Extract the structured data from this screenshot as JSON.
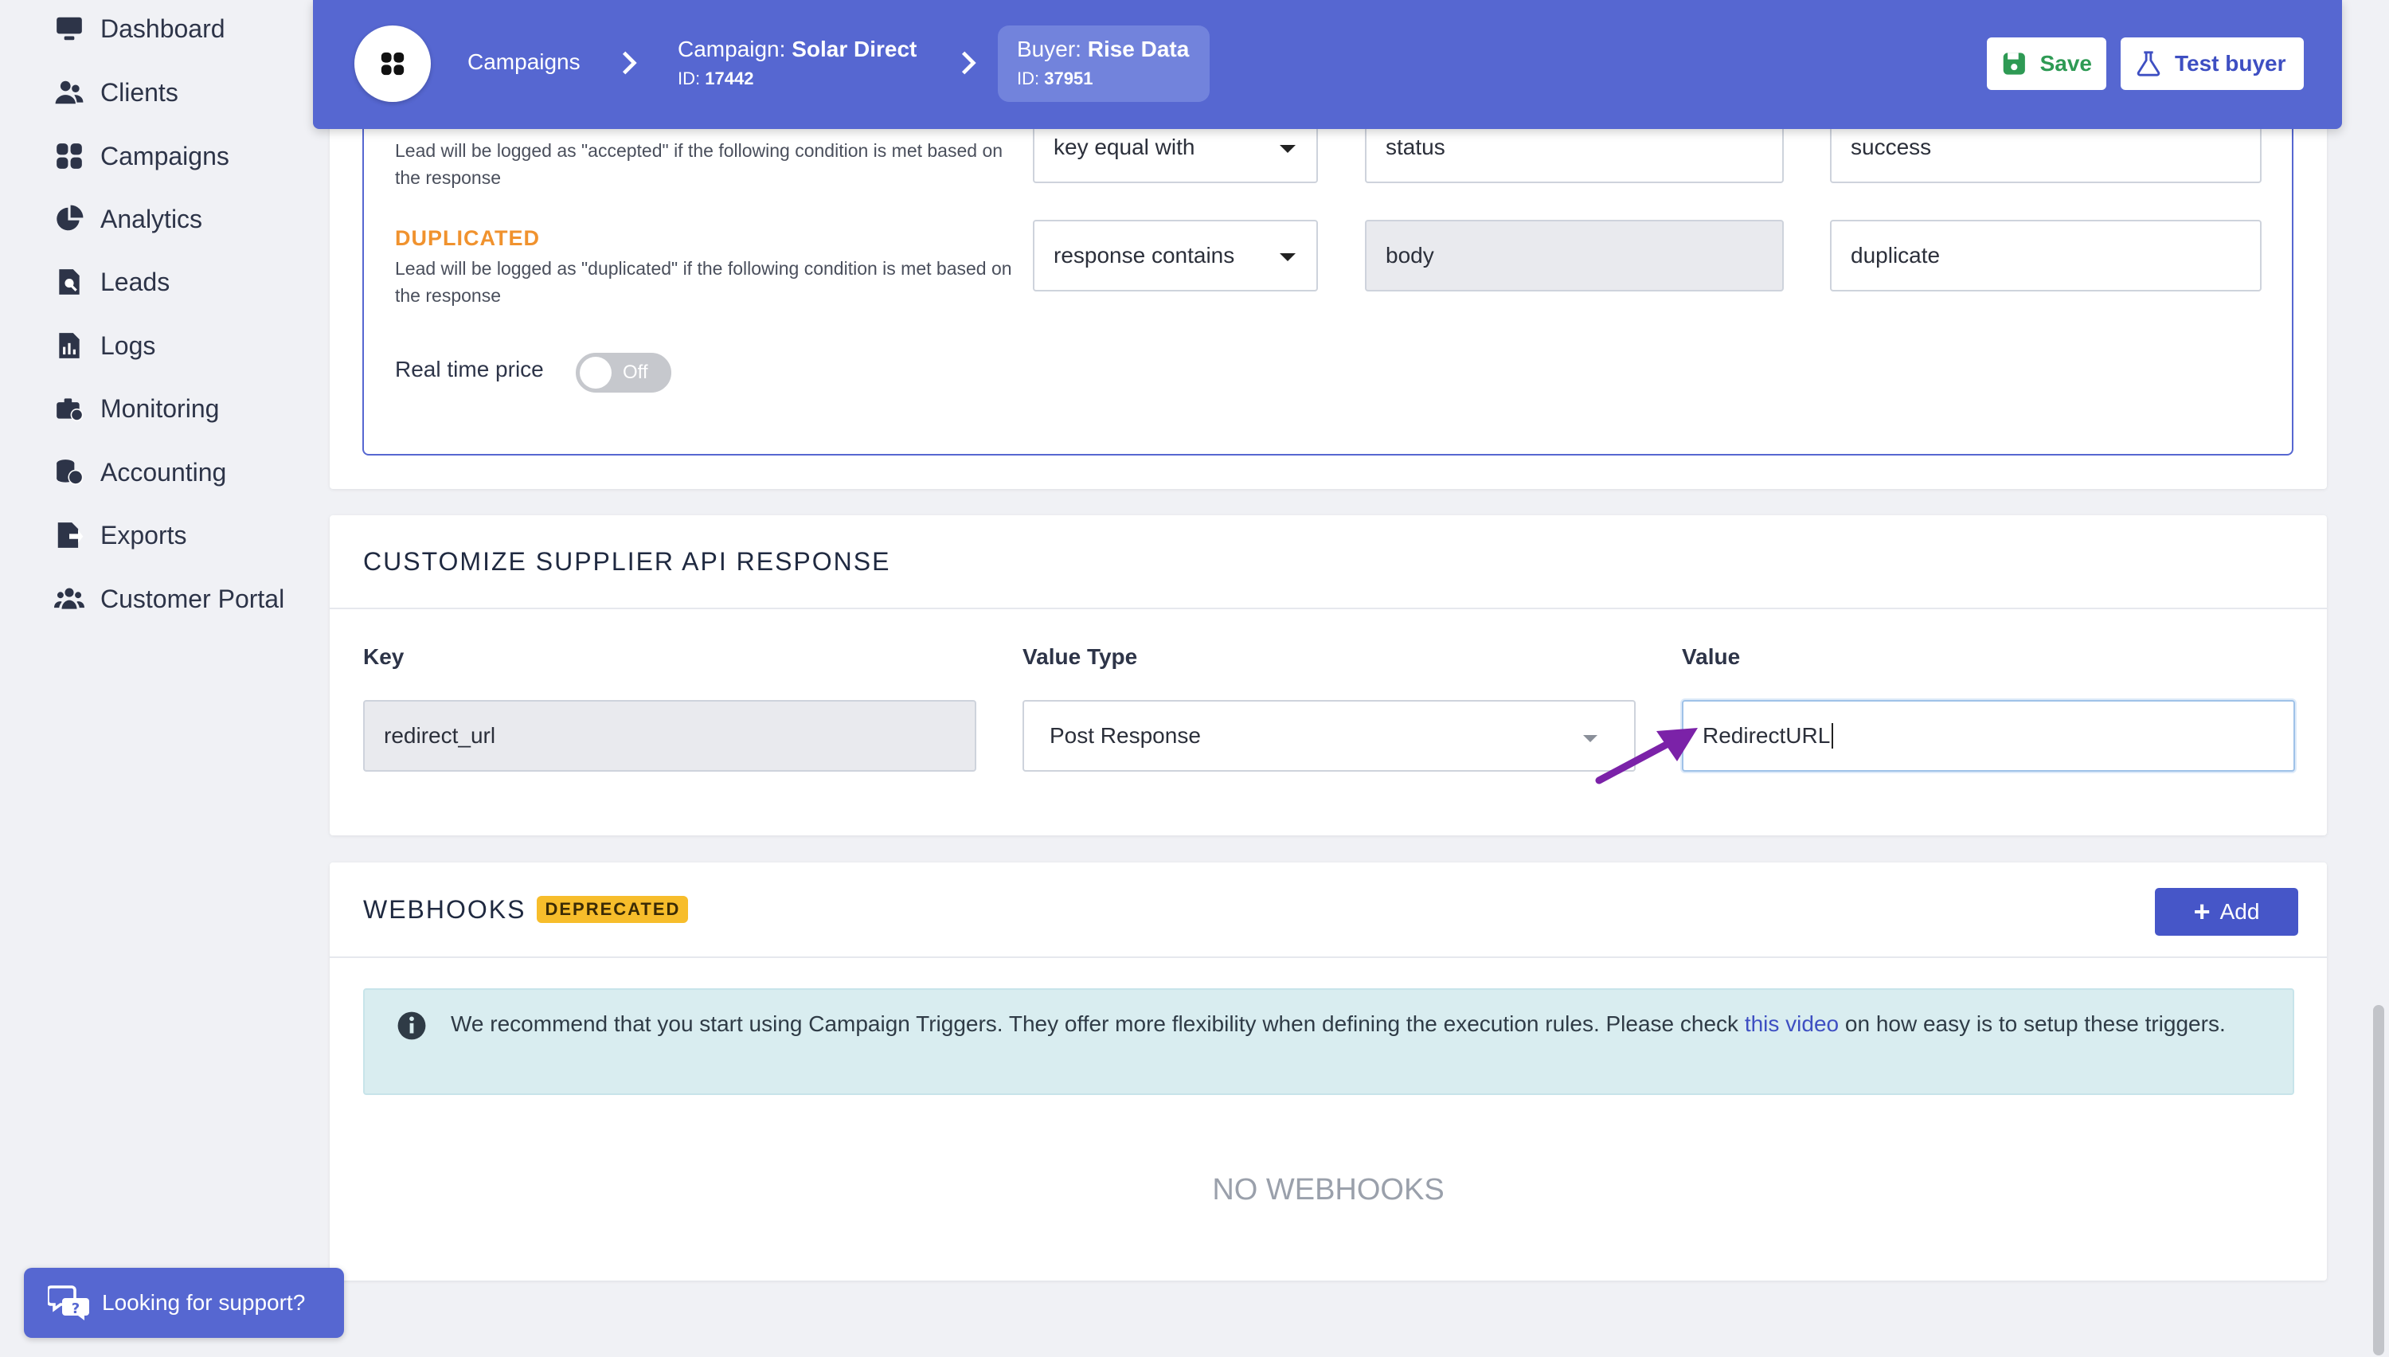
{
  "sidebar": {
    "items": [
      {
        "label": "Dashboard",
        "icon": "monitor-icon"
      },
      {
        "label": "Clients",
        "icon": "users-icon"
      },
      {
        "label": "Campaigns",
        "icon": "grid-icon"
      },
      {
        "label": "Analytics",
        "icon": "pie-chart-icon"
      },
      {
        "label": "Leads",
        "icon": "lead-search-icon"
      },
      {
        "label": "Logs",
        "icon": "file-chart-icon"
      },
      {
        "label": "Monitoring",
        "icon": "briefcase-clock-icon"
      },
      {
        "label": "Accounting",
        "icon": "coins-icon"
      },
      {
        "label": "Exports",
        "icon": "file-export-icon"
      },
      {
        "label": "Customer Portal",
        "icon": "people-group-icon"
      }
    ]
  },
  "header": {
    "crumb1": "Campaigns",
    "crumb2_prefix": "Campaign:",
    "crumb2_name": "Solar Direct",
    "crumb2_id_prefix": "ID:",
    "crumb2_id": "17442",
    "crumb3_prefix": "Buyer:",
    "crumb3_name": "Rise Data",
    "crumb3_id_prefix": "ID:",
    "crumb3_id": "37951",
    "save_label": "Save",
    "test_label": "Test buyer"
  },
  "response_rules": {
    "accepted_desc": "Lead will be logged as \"accepted\" if the following condition is met based on the response",
    "accepted_condition": "key equal with",
    "accepted_key": "status",
    "accepted_value": "success",
    "duplicated_title": "DUPLICATED",
    "duplicated_desc": "Lead will be logged as \"duplicated\" if the following condition is met based on the response",
    "duplicated_condition": "response contains",
    "duplicated_key": "body",
    "duplicated_value": "duplicate",
    "realtime_label": "Real time price",
    "realtime_state": "Off"
  },
  "supplier_response": {
    "title": "CUSTOMIZE SUPPLIER API RESPONSE",
    "key_label": "Key",
    "value_type_label": "Value Type",
    "value_label": "Value",
    "key": "redirect_url",
    "value_type": "Post Response",
    "value": "RedirectURL"
  },
  "webhooks": {
    "title": "WEBHOOKS",
    "badge": "DEPRECATED",
    "add_label": "Add",
    "alert_pre": "We recommend that you start using Campaign Triggers. They offer more flexibility when defining the execution rules. Please check ",
    "alert_link": "this video",
    "alert_post": " on how easy is to setup these triggers.",
    "empty": "NO WEBHOOKS"
  },
  "support": {
    "label": "Looking for support?"
  },
  "colors": {
    "primary": "#5667d1",
    "warning": "#f0922e",
    "badge": "#f7bd2b",
    "annotation_arrow": "#7b22a8"
  }
}
